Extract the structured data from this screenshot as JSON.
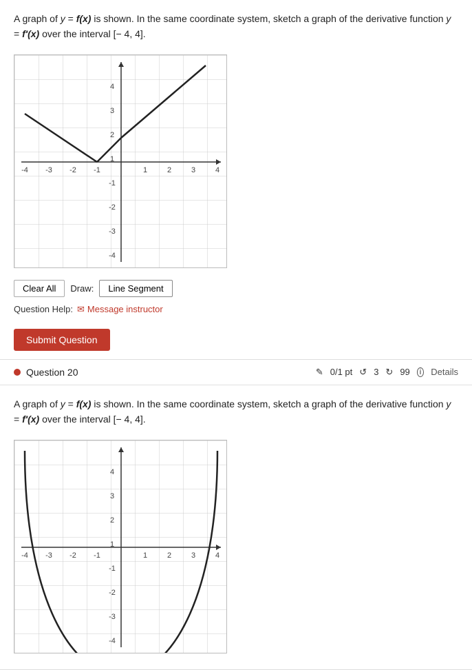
{
  "question19": {
    "text_part1": "A graph of ",
    "y_label": "y",
    "eq1": " = ",
    "fx_label": "f(x)",
    "text_part2": " is shown. In the same coordinate system, sketch a graph of the derivative function ",
    "y2_label": "y",
    "eq2": " = ",
    "fpx_label": "f′(x)",
    "text_part3": " over the interval [− 4, 4].",
    "clear_all": "Clear All",
    "draw_label": "Draw:",
    "draw_mode": "Line Segment",
    "question_help_label": "Question Help:",
    "message_instructor": "Message instructor",
    "submit_button": "Submit Question"
  },
  "question20": {
    "header": "Question 20",
    "score": "0/1 pt",
    "retries": "3",
    "submissions": "99",
    "details": "Details",
    "text_part1": "A graph of ",
    "y_label": "y",
    "eq1": " = ",
    "fx_label": "f(x)",
    "text_part2": " is shown. In the same coordinate system, sketch a graph of the derivative function ",
    "y2_label": "y",
    "eq2": " = ",
    "fpx_label": "f′(x)",
    "text_part3": " over the interval [− 4, 4]."
  }
}
